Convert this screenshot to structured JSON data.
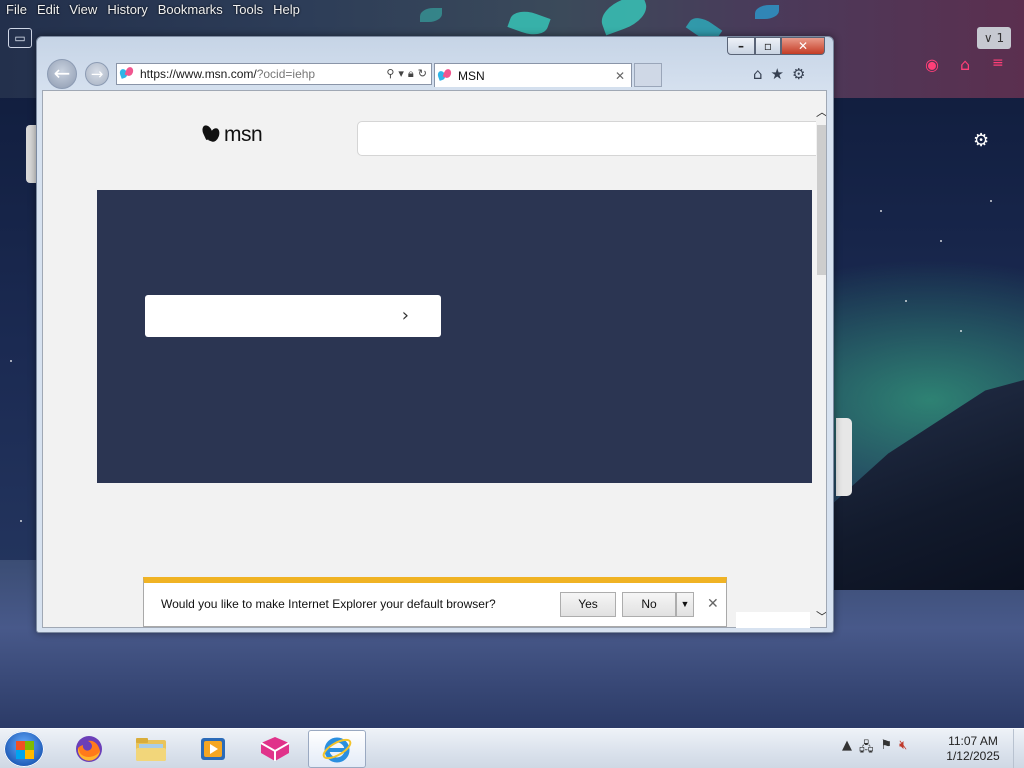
{
  "firefox": {
    "menu": [
      "File",
      "Edit",
      "View",
      "History",
      "Bookmarks",
      "Tools",
      "Help"
    ],
    "tab_count": "1"
  },
  "ie": {
    "address_url_host": "https://www.msn.com/",
    "address_url_query": "?ocid=iehp",
    "tab_title": "MSN",
    "page": {
      "logo_text": "msn"
    },
    "notification": {
      "message": "Would you like to make Internet Explorer your default browser?",
      "yes_label": "Yes",
      "no_label": "No"
    }
  },
  "taskbar": {
    "items": [
      "firefox-icon",
      "file-explorer-icon",
      "media-player-icon",
      "app-icon",
      "internet-explorer-icon"
    ],
    "active_item": "internet-explorer-icon",
    "time": "11:07 AM",
    "date": "1/12/2025"
  },
  "colors": {
    "hero_bg": "#2b3552",
    "notification_accent": "#f0b324",
    "ie_logo": "#2a8fe0"
  }
}
